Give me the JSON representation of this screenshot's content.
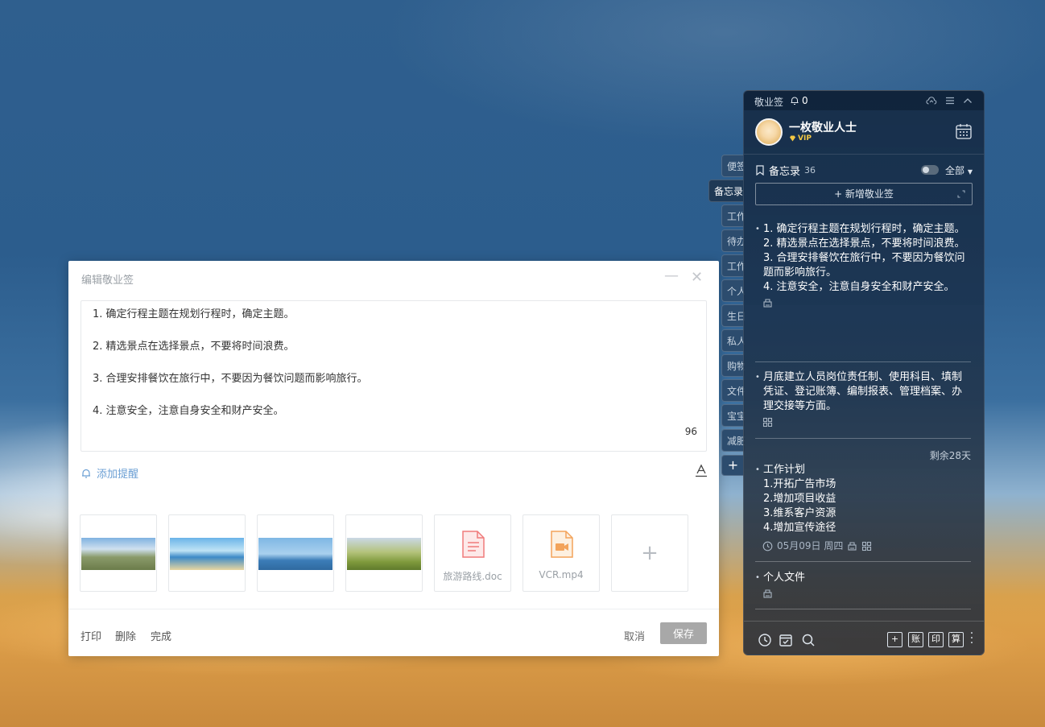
{
  "editor": {
    "title": "编辑敬业签",
    "minimize_icon": "minimize-icon",
    "close_icon": "close-icon",
    "lines": [
      "1. 确定行程主题在规划行程时，确定主题。",
      "2. 精选景点在选择景点，不要将时间浪费。",
      "3. 合理安排餐饮在旅行中，不要因为餐饮问题而影响旅行。",
      "4. 注意安全，注意自身安全和财产安全。"
    ],
    "char_count": "96",
    "reminder_label": "添加提醒",
    "attachments": [
      {
        "kind": "image",
        "name": ""
      },
      {
        "kind": "image",
        "name": ""
      },
      {
        "kind": "image",
        "name": ""
      },
      {
        "kind": "image",
        "name": ""
      },
      {
        "kind": "doc",
        "name": "旅游路线.doc"
      },
      {
        "kind": "video",
        "name": "VCR.mp4"
      }
    ],
    "add_attachment": "+",
    "footer": {
      "print": "打印",
      "delete": "删除",
      "done": "完成",
      "cancel": "取消",
      "save": "保存"
    }
  },
  "side_tabs": [
    "便签",
    "备忘录",
    "工作",
    "待办",
    "工作",
    "个人",
    "生日",
    "私人",
    "购物",
    "文件",
    "宝宝",
    "减肥"
  ],
  "side_tab_active": 1,
  "side_tab_add": "+",
  "panel": {
    "app_name": "敬业签",
    "bell_count": "0",
    "user": {
      "name": "一枚敬业人士",
      "badge": "VIP"
    },
    "memo": {
      "title": "备忘录",
      "count": "36",
      "filter": "全部"
    },
    "new_button": "+ 新增敬业签",
    "notes": [
      {
        "lines": [
          "1. 确定行程主题在规划行程时，确定主题。",
          "",
          "2. 精选景点在选择景点，不要将时间浪费。",
          "",
          "3. 合理安排餐饮在旅行中，不要因为餐饮问",
          "题而影响旅行。",
          "",
          "4. 注意安全，注意自身安全和财产安全。"
        ],
        "date": ""
      },
      {
        "lines": [
          "月底建立人员岗位责任制、使用科目、填制",
          "凭证、登记账簿、编制报表、管理档案、办",
          "理交接等方面。"
        ],
        "date": ""
      },
      {
        "remaining": "剩余28天",
        "lines": [
          "工作计划",
          "1.开拓广告市场",
          "2.增加项目收益",
          "3.维系客户资源",
          "4.增加宣传途径"
        ],
        "date": "05月09日 周四"
      },
      {
        "lines": [
          "个人文件"
        ],
        "date": ""
      }
    ],
    "bottom_boxes": [
      "+",
      "账",
      "印",
      "算"
    ]
  },
  "colors": {
    "accent_link": "#6b9fd4",
    "save_button": "#a8a8a8",
    "vip_gold": "#f2c744",
    "doc_icon": "#f07b7b",
    "video_icon": "#f3a35a"
  }
}
